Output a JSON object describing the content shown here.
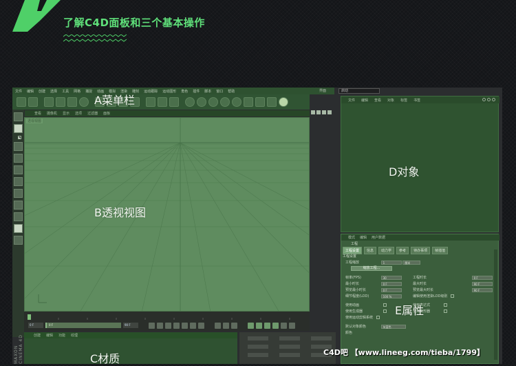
{
  "header": {
    "title": "了解C4D面板和三个基本操作"
  },
  "colors": {
    "accent": "#5fe07a",
    "panel_green": "#2f5330",
    "viewport_green": "#5f8c5f"
  },
  "annotations": {
    "menu": "A菜单栏",
    "viewport": "B透视视图",
    "material": "C材质",
    "object": "D对象",
    "attribute": "E属性"
  },
  "main_menu": [
    "文件",
    "编辑",
    "创建",
    "选择",
    "工具",
    "网格",
    "捕捉",
    "动画",
    "模拟",
    "渲染",
    "雕刻",
    "运动跟踪",
    "运动图形",
    "角色",
    "插件",
    "脚本",
    "窗口",
    "帮助"
  ],
  "layout": {
    "label": "界面",
    "value": "启动"
  },
  "view_menu": [
    "查看",
    "摄像机",
    "显示",
    "选项",
    "过滤器",
    "面板"
  ],
  "viewport_label": "透视视图",
  "material_menu": [
    "创建",
    "编辑",
    "功能",
    "纹理"
  ],
  "brand_vertical": "MAXON CINEMA 4D",
  "object_menu": [
    "文件",
    "编辑",
    "查看",
    "对象",
    "标签",
    "书签"
  ],
  "attribute_panel": {
    "menu": [
      "模式",
      "编辑",
      "用户数据"
    ],
    "title": "工程",
    "tabs": [
      "工程设置",
      "信息",
      "动力学",
      "参考",
      "待办事项",
      "帧插值"
    ],
    "section": "工程设置",
    "scale_label": "工程缩放",
    "scale_value": "1",
    "scale_unit": "厘米",
    "scale_button": "缩放工程...",
    "fps_label": "帧率(FPS)",
    "fps_value": "30",
    "min_time_label": "最小时长",
    "min_time_value": "0 F",
    "preview_min_label": "预览最小时长",
    "preview_min_value": "0 F",
    "lod_label": "细节程度(LOD)",
    "lod_value": "100 %",
    "project_time_label": "工程时长",
    "project_time_value": "0 F",
    "max_time_label": "最大时长",
    "max_time_value": "90 F",
    "preview_max_label": "预览最大时长",
    "preview_max_value": "90 F",
    "render_lod_label": "编辑使用渲染LOD级别",
    "use_anim_label": "使用动画",
    "use_gen_label": "使用生成器",
    "use_motion_label": "使用运动剪辑系统",
    "use_expr_label": "使用表达式",
    "use_deform_label": "使用变形器",
    "default_color_label": "默认对象颜色",
    "default_color_value": "灰蓝色",
    "color_label": "颜色"
  },
  "transport": {
    "start_frame": "0 F",
    "current_frame": "0 F",
    "end_frame": "90 F"
  },
  "watermark": "C4D吧 【www.lineeg.com/tieba/1799】"
}
